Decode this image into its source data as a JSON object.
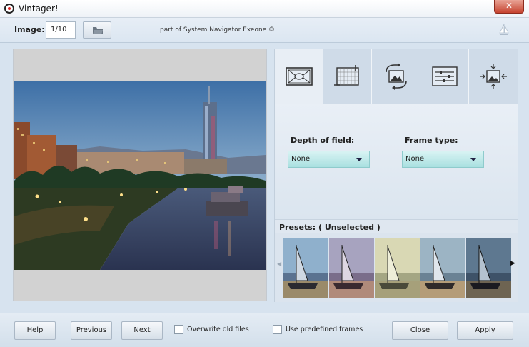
{
  "window": {
    "title": "Vintager!",
    "close_glyph": "✕"
  },
  "toolbar": {
    "image_label": "Image:",
    "image_value": "1/10",
    "credit": "part of System Navigator Exeone ©"
  },
  "tabs": [
    {
      "icon": "vignette-icon",
      "active": true
    },
    {
      "icon": "crop-frame-icon",
      "active": false
    },
    {
      "icon": "rotate-image-icon",
      "active": false
    },
    {
      "icon": "adjust-sliders-icon",
      "active": false
    },
    {
      "icon": "resize-image-icon",
      "active": false
    }
  ],
  "settings": {
    "depth_label": "Depth of field:",
    "depth_value": "None",
    "frame_label": "Frame type:",
    "frame_value": "None"
  },
  "presets": {
    "label": "Presets: ( Unselected )",
    "prev_glyph": "◀",
    "next_glyph": "▶",
    "count": 5
  },
  "footer": {
    "help": "Help",
    "previous": "Previous",
    "next": "Next",
    "overwrite": "Overwrite old files",
    "predefined": "Use predefined frames",
    "close": "Close",
    "apply": "Apply"
  },
  "colors": {
    "background": "#d7e3ef",
    "dropdown": "#a9e0e0",
    "close_button": "#c6432f"
  }
}
